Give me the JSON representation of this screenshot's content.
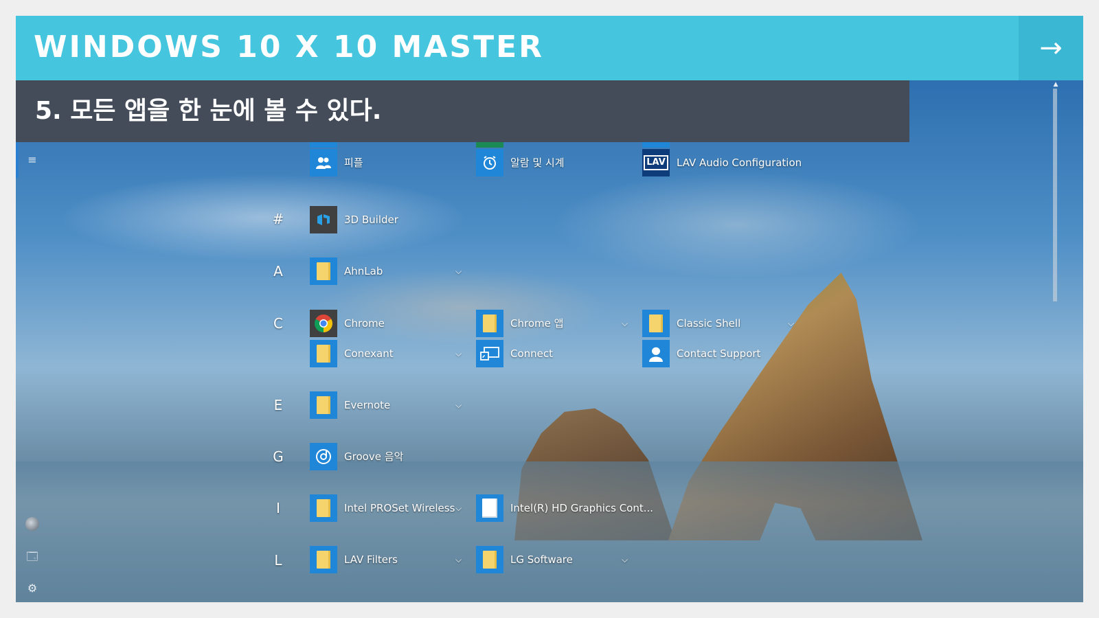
{
  "header": {
    "title": "WINDOWS 10 X 10 MASTER",
    "next_arrow": "→"
  },
  "subtitle": "5. 모든 앱을 한 눈에 볼 수 있다.",
  "colors": {
    "header": "#45c5de",
    "subtitle_band": "#444b59",
    "tile_blue": "#1f86d8",
    "folder": "#f6d46d"
  },
  "left_rail": {
    "menu": "≡",
    "explorer": "🗔",
    "settings": "⚙"
  },
  "sections": {
    "hash": "#",
    "a": "A",
    "c": "C",
    "e": "E",
    "g": "G",
    "i": "I",
    "l": "L"
  },
  "apps": {
    "people": {
      "label": "피플",
      "icon": "people-icon"
    },
    "alarms": {
      "label": "알람 및 시계",
      "icon": "alarm-clock-icon"
    },
    "lav_audio": {
      "label": "LAV Audio Configuration",
      "icon": "lav-logo-icon",
      "glyph": "LAV"
    },
    "builder3d": {
      "label": "3D Builder",
      "icon": "3d-builder-icon"
    },
    "ahnlab": {
      "label": "AhnLab",
      "icon": "folder-icon",
      "expandable": true
    },
    "chrome": {
      "label": "Chrome",
      "icon": "chrome-icon"
    },
    "chrome_apps": {
      "label": "Chrome 앱",
      "icon": "folder-icon",
      "expandable": true
    },
    "classic_shell": {
      "label": "Classic Shell",
      "icon": "folder-icon",
      "expandable": true
    },
    "conexant": {
      "label": "Conexant",
      "icon": "folder-icon",
      "expandable": true
    },
    "connect": {
      "label": "Connect",
      "icon": "connect-icon"
    },
    "contact_support": {
      "label": "Contact Support",
      "icon": "person-icon"
    },
    "evernote": {
      "label": "Evernote",
      "icon": "folder-icon",
      "expandable": true
    },
    "groove": {
      "label": "Groove 음악",
      "icon": "groove-music-icon"
    },
    "intel_proset": {
      "label": "Intel PROSet Wireless",
      "icon": "folder-icon",
      "expandable": true
    },
    "intel_hd": {
      "label": "Intel(R) HD Graphics Cont...",
      "icon": "document-icon"
    },
    "lav_filters": {
      "label": "LAV Filters",
      "icon": "folder-icon",
      "expandable": true
    },
    "lg_software": {
      "label": "LG Software",
      "icon": "folder-icon",
      "expandable": true
    }
  },
  "chevron": "⌵"
}
